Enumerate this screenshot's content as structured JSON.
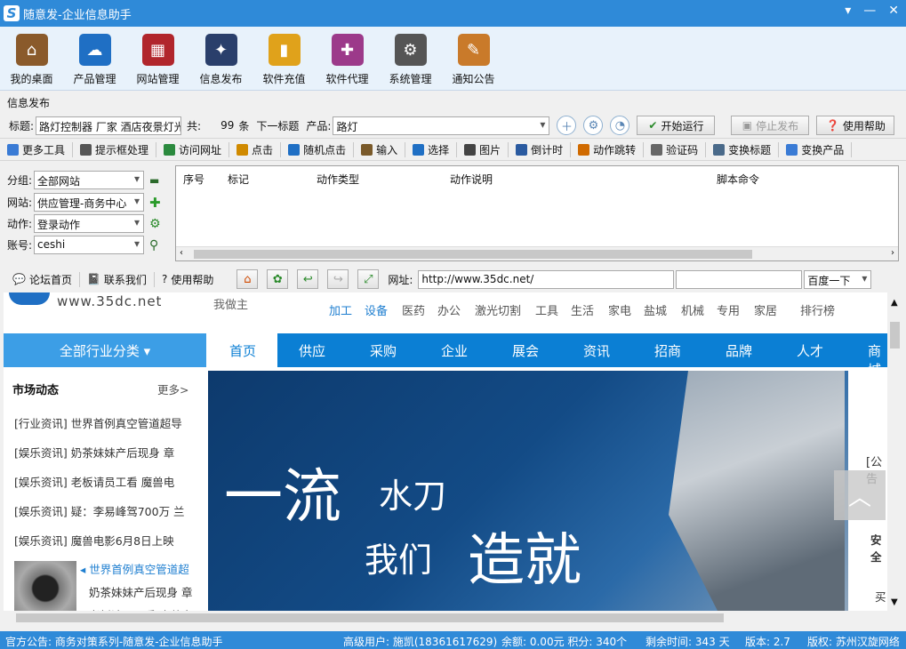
{
  "window": {
    "title": "随意发-企业信息助手",
    "logo": "S",
    "controls": [
      "▾",
      "—",
      "✕"
    ]
  },
  "toolbar": [
    {
      "label": "我的桌面",
      "icon": "house-icon",
      "color": "#8a5a2b",
      "glyph": "⌂"
    },
    {
      "label": "产品管理",
      "icon": "cloud-icon",
      "color": "#1f6fc4",
      "glyph": "☁"
    },
    {
      "label": "网站管理",
      "icon": "building-icon",
      "color": "#b1262c",
      "glyph": "▦"
    },
    {
      "label": "信息发布",
      "icon": "magic-wand-icon",
      "color": "#2a3f6b",
      "glyph": "✦"
    },
    {
      "label": "软件充值",
      "icon": "chart-bars-icon",
      "color": "#e0a21b",
      "glyph": "▮"
    },
    {
      "label": "软件代理",
      "icon": "gift-icon",
      "color": "#9c3a8a",
      "glyph": "✚"
    },
    {
      "label": "系统管理",
      "icon": "gear-icon",
      "color": "#555555",
      "glyph": "⚙"
    },
    {
      "label": "通知公告",
      "icon": "notepad-icon",
      "color": "#c97a2a",
      "glyph": "✎"
    }
  ],
  "section_title": "信息发布",
  "row1": {
    "title_label": "标题:",
    "title_value": "路灯控制器 厂家 酒店夜景灯光",
    "count_label": "共:",
    "count": "99",
    "count_unit": "条",
    "next_label": "下一标题",
    "product_label": "产品:",
    "product_value": "路灯",
    "start": "开始运行",
    "stop": "停止发布",
    "help": "使用帮助"
  },
  "tools": [
    {
      "label": "更多工具",
      "color": "#3a7bd5"
    },
    {
      "label": "提示框处理",
      "color": "#555"
    },
    {
      "label": "访问网址",
      "color": "#2b8a3e"
    },
    {
      "label": "点击",
      "color": "#d08a00"
    },
    {
      "label": "随机点击",
      "color": "#1f6fc4"
    },
    {
      "label": "输入",
      "color": "#7a5a2a"
    },
    {
      "label": "选择",
      "color": "#1f6fc4"
    },
    {
      "label": "图片",
      "color": "#444"
    },
    {
      "label": "倒计时",
      "color": "#2a5aa0"
    },
    {
      "label": "动作跳转",
      "color": "#d06a00"
    },
    {
      "label": "验证码",
      "color": "#666"
    },
    {
      "label": "变换标题",
      "color": "#4a6a8a"
    },
    {
      "label": "变换产品",
      "color": "#3a7bd5"
    }
  ],
  "left": {
    "group_label": "分组:",
    "group": "全部网站",
    "site_label": "网站:",
    "site": "供应管理-商务中心",
    "action_label": "动作:",
    "action": "登录动作",
    "account_label": "账号:",
    "account": "ceshi"
  },
  "grid_headers": [
    "序号",
    "标记",
    "动作类型",
    "动作说明",
    "脚本命令"
  ],
  "nav": {
    "forum": "论坛首页",
    "contact": "联系我们",
    "help": "使用帮助",
    "url_label": "网址:",
    "url": "http://www.35dc.net/",
    "engine": "百度一下"
  },
  "site": {
    "logo_text": "www.35dc.net",
    "slogan": "我做主",
    "topcats": [
      "加工",
      "设备",
      "医药",
      "办公",
      "激光切割",
      "工具",
      "生活",
      "家电",
      "盐城",
      "机械",
      "专用",
      "家居",
      "排行榜"
    ],
    "all_cat": "全部行业分类 ▾",
    "navitems": [
      "首页",
      "供应",
      "采购",
      "企业",
      "展会",
      "资讯",
      "招商",
      "品牌",
      "人才",
      "商城"
    ],
    "market_title": "市场动态",
    "more": "更多>",
    "news": [
      "[行业资讯] 世界首例真空管道超导",
      "[娱乐资讯] 奶茶妹妹产后现身 章",
      "[娱乐资讯] 老板请员工看 魔兽电",
      "[娱乐资讯] 疑：李易峰驾700万 兰",
      "[娱乐资讯] 魔兽电影6月8日上映"
    ],
    "thumb_news": [
      "世界首例真空管道超",
      "奶茶妹妹产后现身 章",
      "老板请员工看 魔兽电"
    ],
    "banner_line1a": "一流",
    "banner_line1b": "水刀",
    "banner_line2a": "我们",
    "banner_line2b": "造就",
    "right_texts": [
      "[公告",
      "安全",
      "买"
    ]
  },
  "status": {
    "notice": "官方公告: 商务对策系列-随意发-企业信息助手",
    "user": "高级用户: 施凯(18361617629)",
    "balance": "余额: 0.00元 积分: 340个",
    "remain": "剩余时间: 343 天",
    "version": "版本: 2.7",
    "copyright": "版权: 苏州汉旋网络"
  }
}
